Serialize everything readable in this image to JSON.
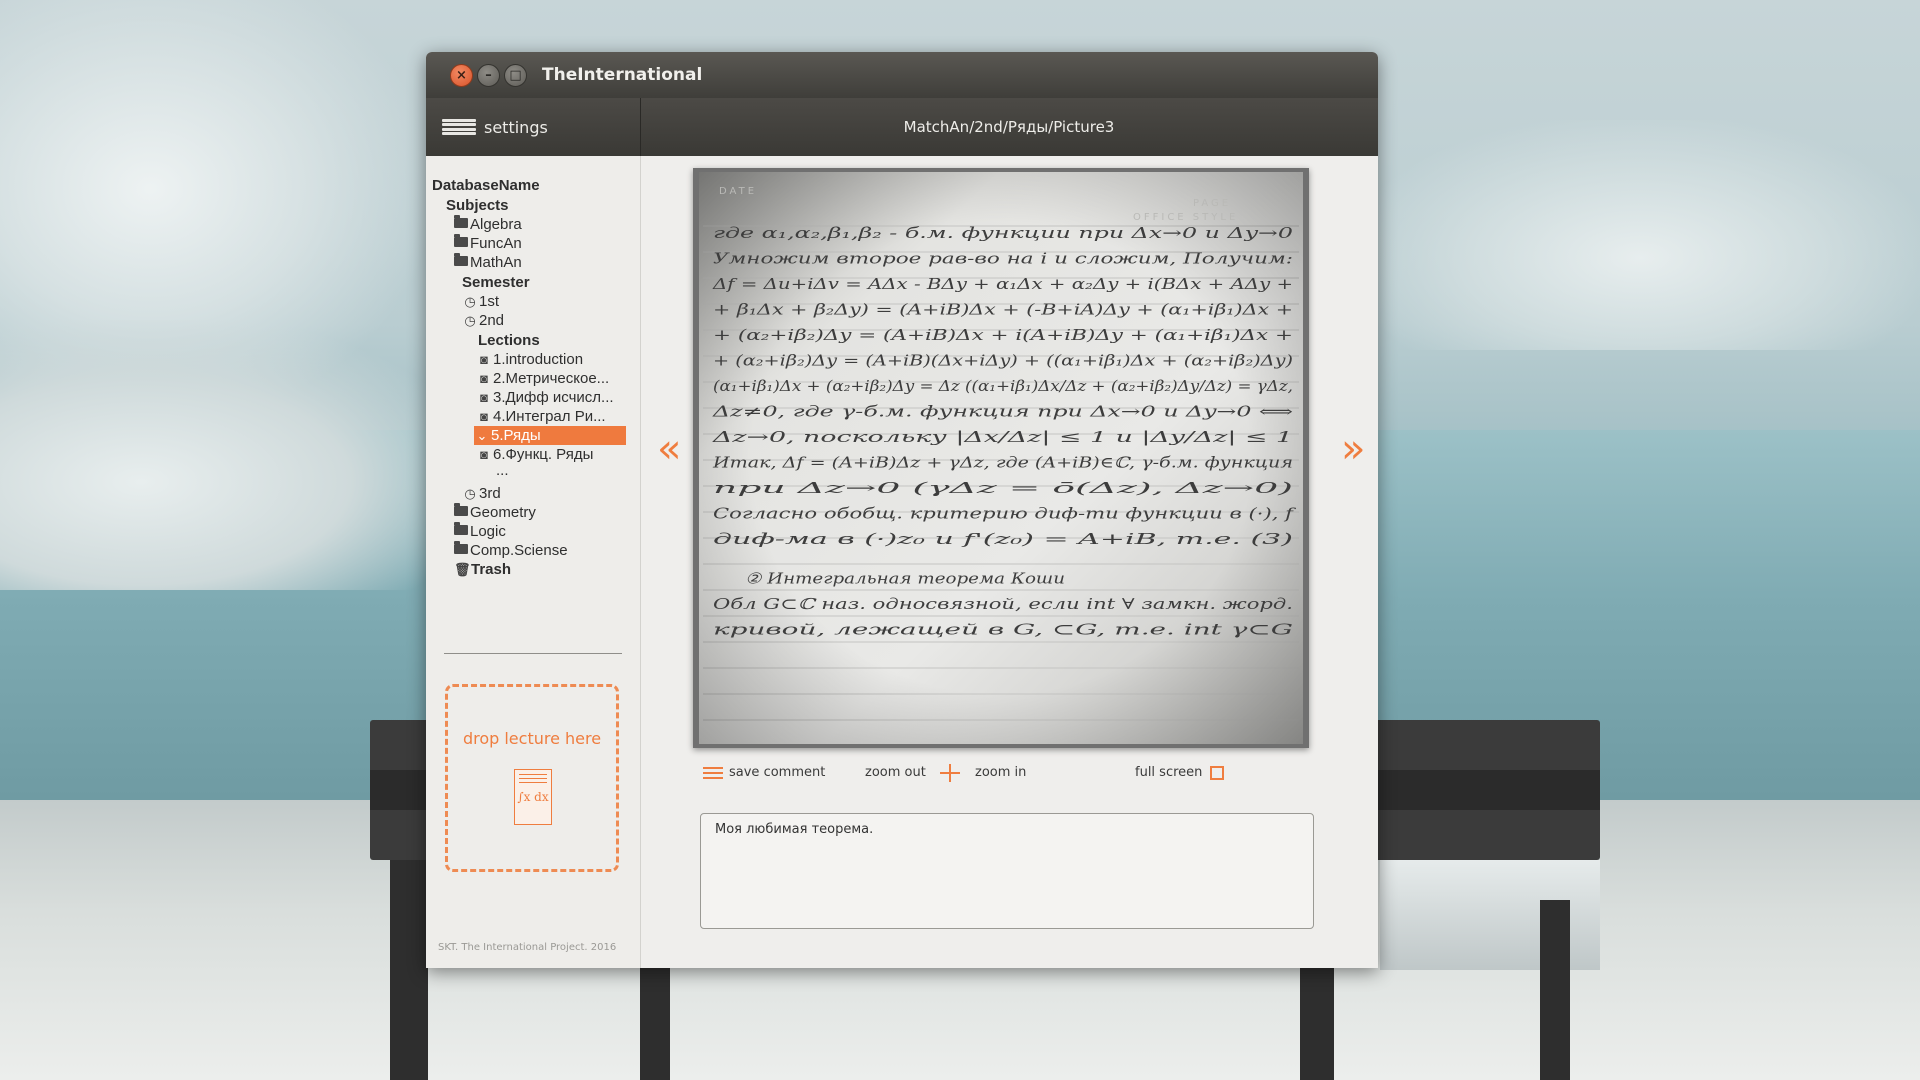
{
  "window": {
    "title": "TheInternational",
    "close_label": "×",
    "min_label": "–",
    "max_label": "□"
  },
  "toolbar": {
    "settings_label": "settings",
    "breadcrumb": "MatchAn/2nd/Ряды/Picture3"
  },
  "tree": {
    "database": "DatabaseName",
    "subjects": "Subjects",
    "items": [
      {
        "label": "Algebra",
        "type": "folder"
      },
      {
        "label": "FuncAn",
        "type": "folder"
      },
      {
        "label": "MathAn",
        "type": "folder"
      },
      {
        "label": "Semester",
        "type": "header"
      },
      {
        "label": "1st",
        "type": "clock"
      },
      {
        "label": "2nd",
        "type": "clock"
      },
      {
        "label": "Lections",
        "type": "header"
      },
      {
        "label": "1.introduction",
        "type": "camera"
      },
      {
        "label": "2.Метрическое...",
        "type": "camera"
      },
      {
        "label": "3.Дифф исчисл...",
        "type": "camera"
      },
      {
        "label": "4.Интеграл Ри...",
        "type": "camera"
      },
      {
        "label": "5.Ряды",
        "type": "selected"
      },
      {
        "label": "6.Функц. Ряды",
        "type": "camera"
      },
      {
        "label": "...",
        "type": "more"
      },
      {
        "label": "3rd",
        "type": "clock"
      },
      {
        "label": "Geometry",
        "type": "folder"
      },
      {
        "label": "Logic",
        "type": "folder"
      },
      {
        "label": "Comp.Sciense",
        "type": "folder"
      },
      {
        "label": "Trash",
        "type": "trash"
      }
    ]
  },
  "dropzone": {
    "label": "drop lecture here",
    "formula": "∫x dx"
  },
  "footer": "SKT. The International Project. 2016",
  "viewer": {
    "prev_arrow": "«",
    "next_arrow": "»",
    "page_header_date": "DATE",
    "page_header_page": "PAGE",
    "page_header_style": "OFFICE STYLE",
    "lines": [
      "где α₁,α₂,β₁,β₂ - б.м. функции при Δx→0 и Δy→0",
      "Умножим второе рав-во на i и сложим, Получим:",
      "Δf = Δu+iΔv = AΔx - BΔy + α₁Δx + α₂Δy + i(BΔx + AΔy +",
      "+ β₁Δx + β₂Δy) = (A+iB)Δx + (-B+iA)Δy + (α₁+iβ₁)Δx +",
      "+ (α₂+iβ₂)Δy = (A+iB)Δx + i(A+iB)Δy + (α₁+iβ₁)Δx +",
      "+ (α₂+iβ₂)Δy = (A+iB)(Δx+iΔy) + ((α₁+iβ₁)Δx + (α₂+iβ₂)Δy)",
      "(α₁+iβ₁)Δx + (α₂+iβ₂)Δy = Δz ((α₁+iβ₁)Δx/Δz + (α₂+iβ₂)Δy/Δz) = γΔz,",
      "Δz≠0, где γ-б.м. функция при Δx→0 и Δy→0 ⟺",
      "Δz→0, поскольку |Δx/Δz| ≤ 1 и |Δy/Δz| ≤ 1",
      "Итак, Δf = (A+iB)Δz + γΔz, где (A+iB)∈ℂ, γ-б.м. функция",
      "при Δz→0 (γΔz = ō(Δz), Δz→0)",
      "Согласно обобщ. критерию диф-ти функции в (·), f",
      "диф-ма в (·)z₀ и f'(z₀) = A+iB, т.е. (3)",
      "② Интегральная теорема Коши",
      "Обл G⊂ℂ наз. односвязной, если int ∀ замкн. жорд.",
      "кривой, лежащей в G, ⊂G, т.е. int γ⊂G"
    ]
  },
  "controls": {
    "save_comment": "save comment",
    "zoom_out": "zoom out",
    "zoom_in": "zoom in",
    "full_screen": "full screen"
  },
  "comment": {
    "value": "Моя любимая теорема."
  },
  "colors": {
    "accent": "#ef7a3e",
    "titlebar": "#3f3e3a",
    "panel": "#efeeec"
  }
}
